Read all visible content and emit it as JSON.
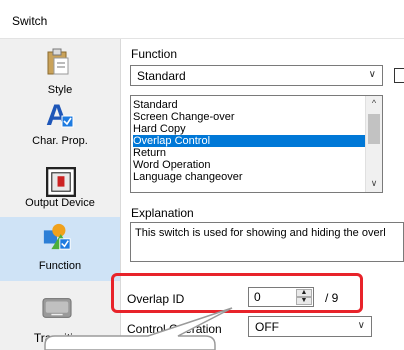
{
  "window": {
    "title": "Switch"
  },
  "nav": {
    "items": [
      {
        "label": "Style",
        "icon": "clipboard-icon"
      },
      {
        "label": "Char. Prop.",
        "icon": "font-letter-icon"
      },
      {
        "label": "Output Device",
        "icon": "output-device-icon"
      },
      {
        "label": "Function",
        "icon": "function-shapes-icon",
        "selected": true
      },
      {
        "label": "Transition",
        "icon": "transition-icon"
      }
    ]
  },
  "function": {
    "label": "Function",
    "selected": "Standard",
    "options": [
      "Standard",
      "Screen Change-over",
      "Hard Copy",
      "Overlap Control",
      "Return",
      "Word Operation",
      "Language changeover"
    ],
    "selected_index": 3
  },
  "explanation": {
    "label": "Explanation",
    "text": "This switch is used for showing and hiding the overl"
  },
  "overlap_id": {
    "label": "Overlap ID",
    "value": "0",
    "max": "/ 9"
  },
  "control_operation": {
    "label": "Control Operation",
    "value": "OFF"
  },
  "colors": {
    "accent": "#0078d7",
    "highlight": "#e8232a",
    "nav_bg": "#f0f0f0"
  }
}
